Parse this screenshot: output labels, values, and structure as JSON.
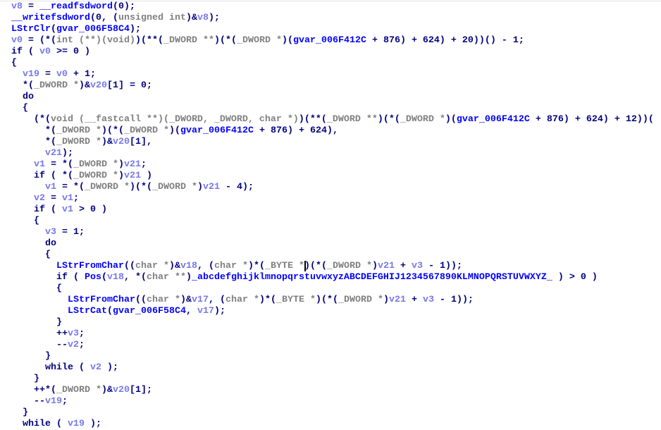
{
  "colors": {
    "keyword": "#000080",
    "variable": "#7878e8",
    "type": "#808080",
    "function": "#0000ff"
  },
  "code": [
    [
      [
        "k",
        "  "
      ],
      [
        "v",
        "v8"
      ],
      [
        "k",
        " = "
      ],
      [
        "f",
        "__readfsdword"
      ],
      [
        "k",
        "(0);"
      ]
    ],
    [
      [
        "k",
        "  "
      ],
      [
        "f",
        "__writefsdword"
      ],
      [
        "k",
        "(0, ("
      ],
      [
        "t",
        "unsigned int"
      ],
      [
        "k",
        ")&"
      ],
      [
        "v",
        "v8"
      ],
      [
        "k",
        ");"
      ]
    ],
    [
      [
        "k",
        "  "
      ],
      [
        "f",
        "LStrClr"
      ],
      [
        "k",
        "("
      ],
      [
        "f",
        "gvar_006F58C4"
      ],
      [
        "k",
        ");"
      ]
    ],
    [
      [
        "k",
        "  "
      ],
      [
        "v",
        "v0"
      ],
      [
        "k",
        " = (*("
      ],
      [
        "t",
        "int (**)(void)"
      ],
      [
        "k",
        ")(**("
      ],
      [
        "t",
        "_DWORD **"
      ],
      [
        "k",
        ")(*("
      ],
      [
        "t",
        "_DWORD *"
      ],
      [
        "k",
        ")("
      ],
      [
        "f",
        "gvar_006F412C"
      ],
      [
        "k",
        " + 876) + 624) + 20))() - 1;"
      ]
    ],
    [
      [
        "k",
        "  if ( "
      ],
      [
        "v",
        "v0"
      ],
      [
        "k",
        " >= 0 )"
      ]
    ],
    [
      [
        "k",
        "  {"
      ]
    ],
    [
      [
        "k",
        "    "
      ],
      [
        "v",
        "v19"
      ],
      [
        "k",
        " = "
      ],
      [
        "v",
        "v0"
      ],
      [
        "k",
        " + 1;"
      ]
    ],
    [
      [
        "k",
        "    *("
      ],
      [
        "t",
        "_DWORD *"
      ],
      [
        "k",
        ")&"
      ],
      [
        "v",
        "v20"
      ],
      [
        "k",
        "[1] = 0;"
      ]
    ],
    [
      [
        "k",
        "    do"
      ]
    ],
    [
      [
        "k",
        "    {"
      ]
    ],
    [
      [
        "k",
        "      (*("
      ],
      [
        "t",
        "void (__fastcall **)(_DWORD, _DWORD, char *)"
      ],
      [
        "k",
        ")(**("
      ],
      [
        "t",
        "_DWORD **"
      ],
      [
        "k",
        ")(*("
      ],
      [
        "t",
        "_DWORD *"
      ],
      [
        "k",
        ")("
      ],
      [
        "f",
        "gvar_006F412C"
      ],
      [
        "k",
        " + 876) + 624) + 12))("
      ]
    ],
    [
      [
        "k",
        "        *("
      ],
      [
        "t",
        "_DWORD *"
      ],
      [
        "k",
        ")(*("
      ],
      [
        "t",
        "_DWORD *"
      ],
      [
        "k",
        ")("
      ],
      [
        "f",
        "gvar_006F412C"
      ],
      [
        "k",
        " + 876) + 624),"
      ]
    ],
    [
      [
        "k",
        "        *("
      ],
      [
        "t",
        "_DWORD *"
      ],
      [
        "k",
        ")&"
      ],
      [
        "v",
        "v20"
      ],
      [
        "k",
        "[1],"
      ]
    ],
    [
      [
        "k",
        "        "
      ],
      [
        "v",
        "v21"
      ],
      [
        "k",
        ");"
      ]
    ],
    [
      [
        "k",
        "      "
      ],
      [
        "v",
        "v1"
      ],
      [
        "k",
        " = *("
      ],
      [
        "t",
        "_DWORD *"
      ],
      [
        "k",
        ")"
      ],
      [
        "v",
        "v21"
      ],
      [
        "k",
        ";"
      ]
    ],
    [
      [
        "k",
        "      if ( *("
      ],
      [
        "t",
        "_DWORD *"
      ],
      [
        "k",
        ")"
      ],
      [
        "v",
        "v21"
      ],
      [
        "k",
        " )"
      ]
    ],
    [
      [
        "k",
        "        "
      ],
      [
        "v",
        "v1"
      ],
      [
        "k",
        " = *("
      ],
      [
        "t",
        "_DWORD *"
      ],
      [
        "k",
        ")(*("
      ],
      [
        "t",
        "_DWORD *"
      ],
      [
        "k",
        ")"
      ],
      [
        "v",
        "v21"
      ],
      [
        "k",
        " - 4);"
      ]
    ],
    [
      [
        "k",
        "      "
      ],
      [
        "v",
        "v2"
      ],
      [
        "k",
        " = "
      ],
      [
        "v",
        "v1"
      ],
      [
        "k",
        ";"
      ]
    ],
    [
      [
        "k",
        "      if ( "
      ],
      [
        "v",
        "v1"
      ],
      [
        "k",
        " > 0 )"
      ]
    ],
    [
      [
        "k",
        "      {"
      ]
    ],
    [
      [
        "k",
        "        "
      ],
      [
        "v",
        "v3"
      ],
      [
        "k",
        " = 1;"
      ]
    ],
    [
      [
        "k",
        "        do"
      ]
    ],
    [
      [
        "k",
        "        {"
      ]
    ],
    [
      [
        "k",
        "          "
      ],
      [
        "f",
        "LStrFromChar"
      ],
      [
        "k",
        "(("
      ],
      [
        "t",
        "char *"
      ],
      [
        "k",
        ")&"
      ],
      [
        "v",
        "v18"
      ],
      [
        "k",
        ", ("
      ],
      [
        "t",
        "char *"
      ],
      [
        "k",
        ")*("
      ],
      [
        "t",
        "_BYTE *"
      ],
      [
        "cursor",
        ""
      ],
      [
        "k",
        ")(*("
      ],
      [
        "t",
        "_DWORD *"
      ],
      [
        "k",
        ")"
      ],
      [
        "v",
        "v21"
      ],
      [
        "k",
        " + "
      ],
      [
        "v",
        "v3"
      ],
      [
        "k",
        " - 1));"
      ]
    ],
    [
      [
        "k",
        "          if ( "
      ],
      [
        "f",
        "Pos"
      ],
      [
        "k",
        "("
      ],
      [
        "v",
        "v18"
      ],
      [
        "k",
        ", *("
      ],
      [
        "t",
        "char **"
      ],
      [
        "k",
        ")"
      ],
      [
        "f",
        "_abcdefghijklmnopqrstuvwxyzABCDEFGHIJ1234567890KLMNOPQRSTUVWXYZ_"
      ],
      [
        "k",
        " ) > 0 )"
      ]
    ],
    [
      [
        "k",
        "          {"
      ]
    ],
    [
      [
        "k",
        "            "
      ],
      [
        "f",
        "LStrFromChar"
      ],
      [
        "k",
        "(("
      ],
      [
        "t",
        "char *"
      ],
      [
        "k",
        ")&"
      ],
      [
        "v",
        "v17"
      ],
      [
        "k",
        ", ("
      ],
      [
        "t",
        "char *"
      ],
      [
        "k",
        ")*("
      ],
      [
        "t",
        "_BYTE *"
      ],
      [
        "k",
        ")(*("
      ],
      [
        "t",
        "_DWORD *"
      ],
      [
        "k",
        ")"
      ],
      [
        "v",
        "v21"
      ],
      [
        "k",
        " + "
      ],
      [
        "v",
        "v3"
      ],
      [
        "k",
        " - 1));"
      ]
    ],
    [
      [
        "k",
        "            "
      ],
      [
        "f",
        "LStrCat"
      ],
      [
        "k",
        "("
      ],
      [
        "f",
        "gvar_006F58C4"
      ],
      [
        "k",
        ", "
      ],
      [
        "v",
        "v17"
      ],
      [
        "k",
        ");"
      ]
    ],
    [
      [
        "k",
        "          }"
      ]
    ],
    [
      [
        "k",
        "          ++"
      ],
      [
        "v",
        "v3"
      ],
      [
        "k",
        ";"
      ]
    ],
    [
      [
        "k",
        "          --"
      ],
      [
        "v",
        "v2"
      ],
      [
        "k",
        ";"
      ]
    ],
    [
      [
        "k",
        "        }"
      ]
    ],
    [
      [
        "k",
        "        while ( "
      ],
      [
        "v",
        "v2"
      ],
      [
        "k",
        " );"
      ]
    ],
    [
      [
        "k",
        "      }"
      ]
    ],
    [
      [
        "k",
        "      ++*("
      ],
      [
        "t",
        "_DWORD *"
      ],
      [
        "k",
        ")&"
      ],
      [
        "v",
        "v20"
      ],
      [
        "k",
        "[1];"
      ]
    ],
    [
      [
        "k",
        "      --"
      ],
      [
        "v",
        "v19"
      ],
      [
        "k",
        ";"
      ]
    ],
    [
      [
        "k",
        "    }"
      ]
    ],
    [
      [
        "k",
        "    while ( "
      ],
      [
        "v",
        "v19"
      ],
      [
        "k",
        " );"
      ]
    ]
  ]
}
